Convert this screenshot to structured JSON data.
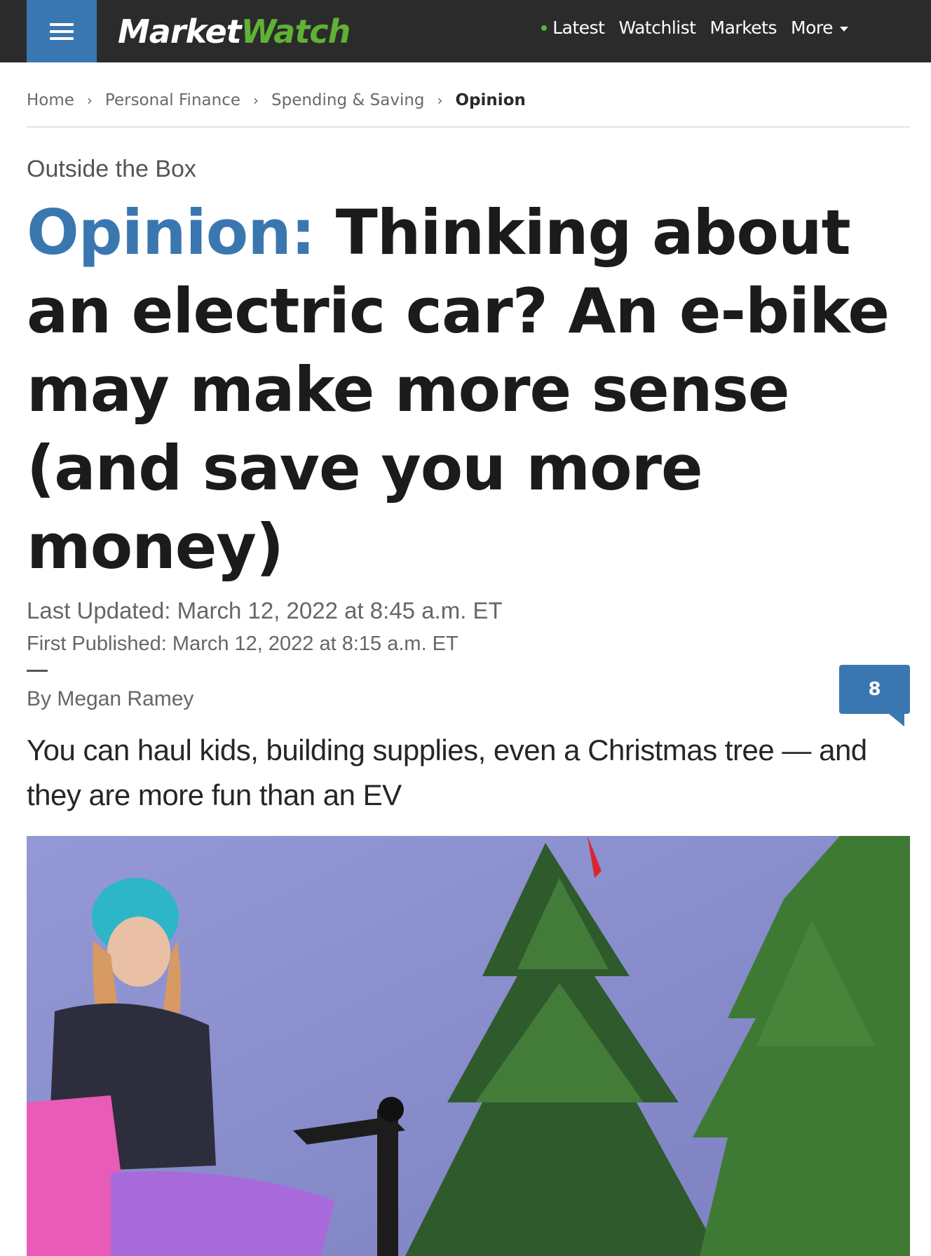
{
  "brand": {
    "market": "Market",
    "watch": "Watch"
  },
  "nav": {
    "items": [
      "Latest",
      "Watchlist",
      "Markets",
      "More"
    ]
  },
  "breadcrumb": [
    "Home",
    "Personal Finance",
    "Spending & Saving",
    "Opinion"
  ],
  "column": "Outside the Box",
  "headline": {
    "label": "Opinion:",
    "text": "Thinking about an electric car? An e-bike may make more sense (and save you more money)"
  },
  "timestamps": {
    "updated": "Last Updated: March 12, 2022 at 8:45 a.m. ET",
    "published": "First Published: March 12, 2022 at 8:15 a.m. ET"
  },
  "byline": "By Megan Ramey",
  "comments": {
    "count": "8"
  },
  "dek": "You can haul kids, building supplies, even a Christmas tree — and they are more fun than an EV",
  "colors": {
    "accent": "#3a77b0",
    "brand_green": "#5fb233",
    "topbar": "#2b2b2b"
  }
}
